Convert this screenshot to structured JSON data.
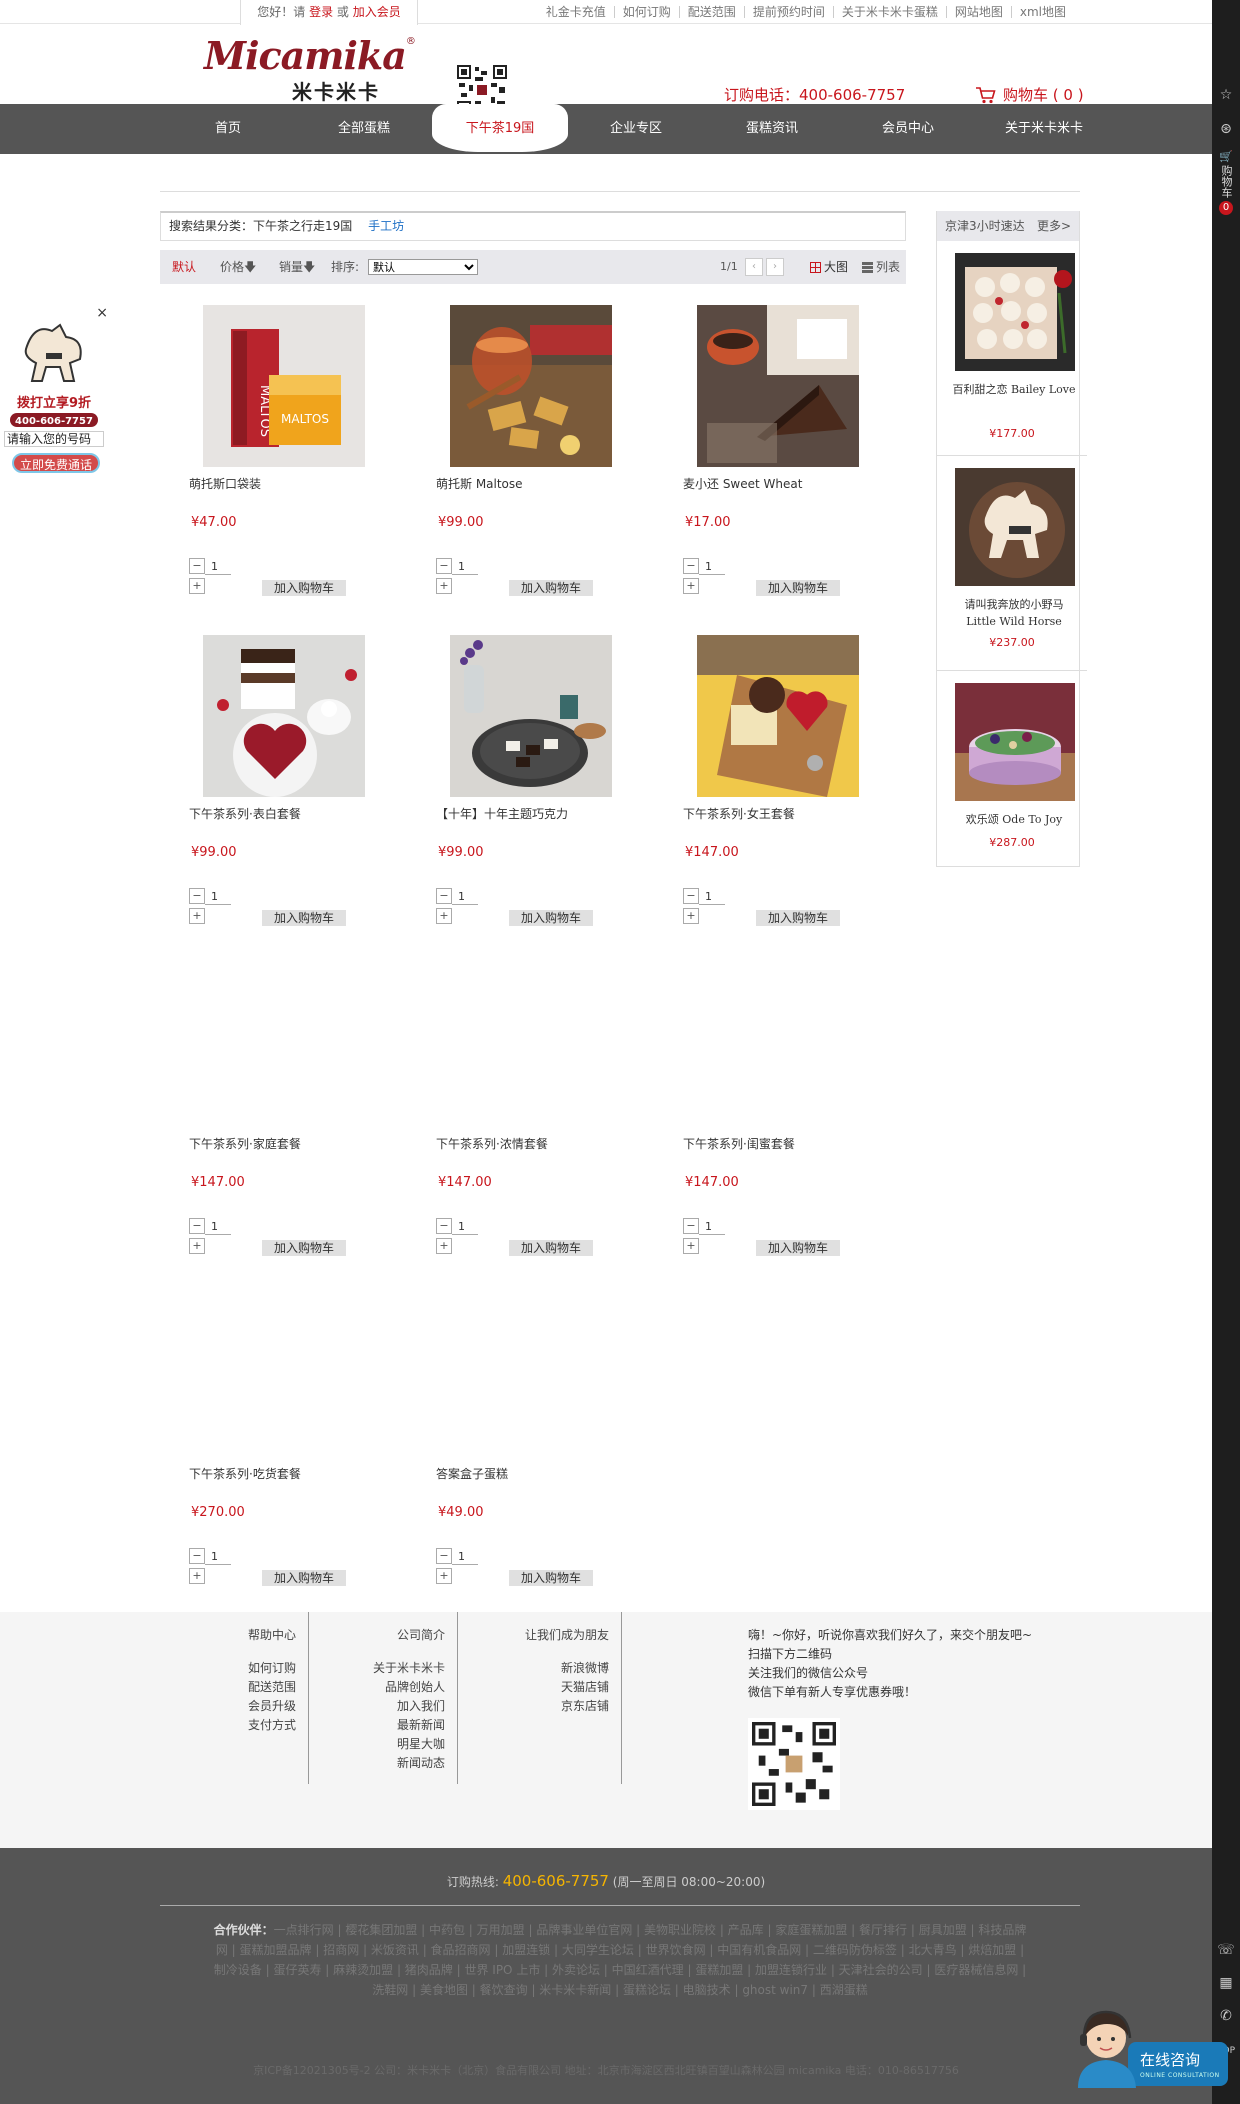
{
  "topbar": {
    "greeting_pre": "您好！请",
    "login": "登录",
    "or": "或",
    "join": "加入会员",
    "links": [
      "礼金卡充值",
      "如何订购",
      "配送范围",
      "提前预约时间",
      "关于米卡米卡蛋糕",
      "网站地图",
      "xml地图"
    ]
  },
  "header": {
    "logo_en": "Micamika",
    "logo_cn": "米卡米卡",
    "phone": "订购电话：400-606-7757",
    "cart": "购物车 ( 0 )"
  },
  "nav": [
    "首页",
    "全部蛋糕",
    "下午茶19国",
    "企业专区",
    "蛋糕资讯",
    "会员中心",
    "关于米卡米卡"
  ],
  "nav_active": 2,
  "crumb": {
    "text": "搜索结果分类：下午茶之行走19国",
    "link": "手工坊"
  },
  "sortbar": {
    "default": "默认",
    "price": "价格",
    "sales": "销量",
    "sort_label": "排序:",
    "sort_value": "默认",
    "page": "1/1",
    "big": "大图",
    "list": "列表"
  },
  "add_label": "加入购物车",
  "products": [
    {
      "name": "萌托斯口袋装",
      "price": "¥47.00",
      "qty": "1",
      "img": "box"
    },
    {
      "name": "萌托斯 Maltose",
      "price": "¥99.00",
      "qty": "1",
      "img": "tea"
    },
    {
      "name": "麦小还 Sweet Wheat",
      "price": "¥17.00",
      "qty": "1",
      "img": "brownie"
    },
    {
      "name": "下午茶系列·表白套餐",
      "price": "¥99.00",
      "qty": "1",
      "img": "heart"
    },
    {
      "name": "【十年】十年主题巧克力",
      "price": "¥99.00",
      "qty": "1",
      "img": "choco"
    },
    {
      "name": "下午茶系列·女王套餐",
      "price": "¥147.00",
      "qty": "1",
      "img": "queen"
    },
    {
      "name": "下午茶系列·家庭套餐",
      "price": "¥147.00",
      "qty": "1",
      "img": ""
    },
    {
      "name": "下午茶系列·浓情套餐",
      "price": "¥147.00",
      "qty": "1",
      "img": ""
    },
    {
      "name": "下午茶系列·闺蜜套餐",
      "price": "¥147.00",
      "qty": "1",
      "img": ""
    },
    {
      "name": "下午茶系列·吃货套餐",
      "price": "¥270.00",
      "qty": "1",
      "img": ""
    },
    {
      "name": "答案盒子蛋糕",
      "price": "¥49.00",
      "qty": "1",
      "img": ""
    }
  ],
  "side": {
    "title": "京津3小时速达",
    "more": "更多>",
    "items": [
      {
        "name": "百利甜之恋 Bailey Love",
        "price": "¥177.00"
      },
      {
        "name": "请叫我奔放的小野马 Little Wild Horse",
        "price": "¥237.00"
      },
      {
        "name": "欢乐颂 Ode To Joy",
        "price": "¥287.00"
      }
    ]
  },
  "floatad": {
    "close": "×",
    "promo": "拨打立享9折",
    "phone": "400-606-7757",
    "placeholder": "请输入您的号码",
    "button": "立即免费通话"
  },
  "toolbar": {
    "cart": "购物车",
    "count": "0"
  },
  "footer": {
    "help": {
      "title": "帮助中心",
      "items": [
        "如何订购",
        "配送范围",
        "会员升级",
        "支付方式"
      ]
    },
    "company": {
      "title": "公司简介",
      "items": [
        "关于米卡米卡",
        "品牌创始人",
        "加入我们",
        "最新新闻",
        "明星大咖",
        "新闻动态"
      ]
    },
    "friends": {
      "title": "让我们成为朋友",
      "items": [
        "新浪微博",
        "天猫店铺",
        "京东店铺"
      ]
    },
    "wechat": [
      "嗨！~你好，听说你喜欢我们好久了，来交个朋友吧~",
      "扫描下方二维码",
      "关注我们的微信公众号",
      "微信下单有新人专享优惠券哦！"
    ]
  },
  "bottom": {
    "hotline_label": "订购热线:",
    "hotline": "400-606-7757",
    "hours": "(周一至周日 08:00~20:00)",
    "partners_label": "合作伙伴：",
    "partners": "一点排行网 | 樱花集团加盟 | 中药包 | 万用加盟 | 品牌事业单位官网 | 美物职业院校 | 产品库 | 家庭蛋糕加盟 | 餐厅排行 | 厨具加盟 | 科技品牌网 | 蛋糕加盟品牌 | 招商网 | 米饭资讯 | 食品招商网 | 加盟连锁 | 大同学生论坛 | 世界饮食网 | 中国有机食品网 | 二维码防伪标签 | 北大青鸟 | 烘焙加盟 | 制冷设备 | 蛋仔英寿 | 麻辣烫加盟 | 猪肉品牌 | 世界 IPO 上市 | 外卖论坛 | 中国红酒代理 | 蛋糕加盟 | 加盟连锁行业 | 天津社会的公司 | 医疗器械信息网 | 洗鞋网 | 美食地图 | 餐饮查询 | 米卡米卡新闻 | 蛋糕论坛 | 电脑技术 | ghost win7 | 西湖蛋糕",
    "copyright": "京ICP备12021305号-2 公司：米卡米卡（北京）食品有限公司 地址：北京市海淀区西北旺镇百望山森林公园 micamika 电话：010-86517756"
  },
  "consult": {
    "label": "在线咨询",
    "sub": "ONLINE CONSULTATION"
  },
  "colors": {
    "accent": "#c8161d",
    "nav": "#555555",
    "link": "#1d6fc5"
  }
}
